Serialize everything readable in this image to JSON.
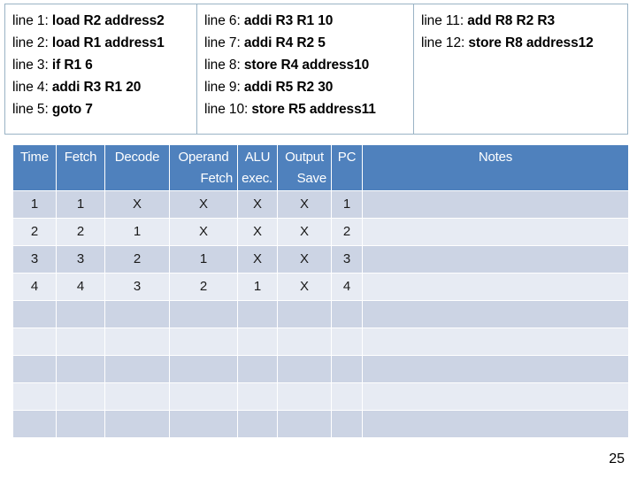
{
  "code_listing": {
    "columns": [
      {
        "lines": [
          {
            "label": "line 1:",
            "instruction": "load R2 address2"
          },
          {
            "label": "line 2:",
            "instruction": "load R1 address1"
          },
          {
            "label": "line 3:",
            "instruction": "if R1 6"
          },
          {
            "label": "line 4:",
            "instruction": "addi R3 R1 20"
          },
          {
            "label": "line 5:",
            "instruction": "goto 7"
          }
        ]
      },
      {
        "lines": [
          {
            "label": "line 6:",
            "instruction": "addi R3 R1 10"
          },
          {
            "label": "line 7:",
            "instruction": "addi R4 R2 5"
          },
          {
            "label": "line 8:",
            "instruction": "store R4 address10"
          },
          {
            "label": "line 9:",
            "instruction": "addi R5 R2 30"
          },
          {
            "label": "line 10:",
            "instruction": "store R5 address11"
          }
        ]
      },
      {
        "lines": [
          {
            "label": "line 11:",
            "instruction": "add R8 R2 R3"
          },
          {
            "label": "line 12:",
            "instruction": "store R8 address12"
          }
        ]
      }
    ]
  },
  "pipeline_table": {
    "headers": [
      {
        "line1": "Time",
        "line2": ""
      },
      {
        "line1": "Fetch",
        "line2": ""
      },
      {
        "line1": "Decode",
        "line2": ""
      },
      {
        "line1": "Operand",
        "line2": "Fetch"
      },
      {
        "line1": "ALU",
        "line2": "exec."
      },
      {
        "line1": "Output",
        "line2": "Save"
      },
      {
        "line1": "PC",
        "line2": ""
      },
      {
        "line1": "Notes",
        "line2": ""
      }
    ],
    "rows": [
      {
        "time": "1",
        "fetch": "1",
        "decode": "X",
        "operand_fetch": "X",
        "alu_exec": "X",
        "output_save": "X",
        "pc": "1",
        "notes": ""
      },
      {
        "time": "2",
        "fetch": "2",
        "decode": "1",
        "operand_fetch": "X",
        "alu_exec": "X",
        "output_save": "X",
        "pc": "2",
        "notes": ""
      },
      {
        "time": "3",
        "fetch": "3",
        "decode": "2",
        "operand_fetch": "1",
        "alu_exec": "X",
        "output_save": "X",
        "pc": "3",
        "notes": ""
      },
      {
        "time": "4",
        "fetch": "4",
        "decode": "3",
        "operand_fetch": "2",
        "alu_exec": "1",
        "output_save": "X",
        "pc": "4",
        "notes": ""
      },
      {
        "time": "",
        "fetch": "",
        "decode": "",
        "operand_fetch": "",
        "alu_exec": "",
        "output_save": "",
        "pc": "",
        "notes": ""
      },
      {
        "time": "",
        "fetch": "",
        "decode": "",
        "operand_fetch": "",
        "alu_exec": "",
        "output_save": "",
        "pc": "",
        "notes": ""
      },
      {
        "time": "",
        "fetch": "",
        "decode": "",
        "operand_fetch": "",
        "alu_exec": "",
        "output_save": "",
        "pc": "",
        "notes": ""
      },
      {
        "time": "",
        "fetch": "",
        "decode": "",
        "operand_fetch": "",
        "alu_exec": "",
        "output_save": "",
        "pc": "",
        "notes": ""
      },
      {
        "time": "",
        "fetch": "",
        "decode": "",
        "operand_fetch": "",
        "alu_exec": "",
        "output_save": "",
        "pc": "",
        "notes": ""
      }
    ],
    "colors": {
      "header_background": "#4f81bd",
      "header_text": "#ffffff",
      "row_odd": "#ccd4e4",
      "row_even": "#e7ebf3",
      "x_mark": "#c0392b"
    }
  },
  "page_number": "25"
}
